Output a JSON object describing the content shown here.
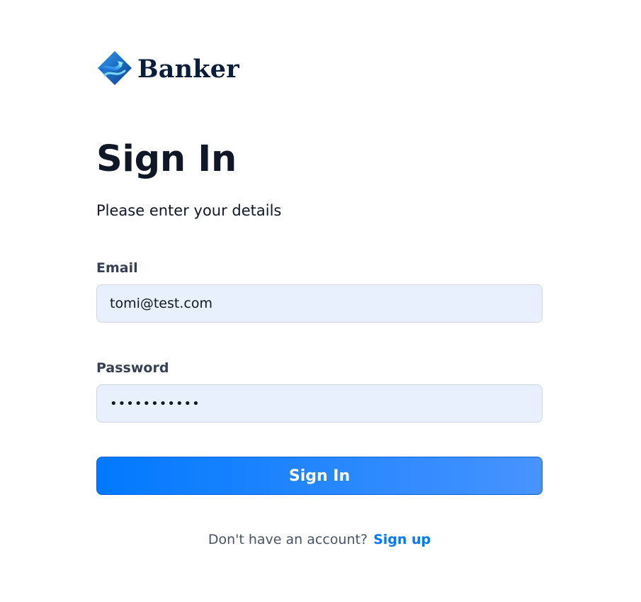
{
  "brand": {
    "name": "Banker",
    "icon": "banker-logo-icon",
    "colors": {
      "text": "#0b1d3a",
      "accent_dark": "#0b3c8c",
      "accent_light": "#2f9cf2"
    }
  },
  "page": {
    "title": "Sign In",
    "subtitle": "Please enter your details"
  },
  "form": {
    "email": {
      "label": "Email",
      "value": "tomi@test.com"
    },
    "password": {
      "label": "Password",
      "value": "•••••••••••"
    },
    "submit_label": "Sign In"
  },
  "footer": {
    "prompt": "Don't have an account?",
    "link_label": "Sign up"
  },
  "colors": {
    "primary": "#0179fe",
    "primary_light": "#4893ff",
    "input_bg": "#e8f0fe",
    "input_border": "#d0d5dd",
    "heading": "#101828",
    "label": "#344054",
    "muted": "#475467"
  }
}
